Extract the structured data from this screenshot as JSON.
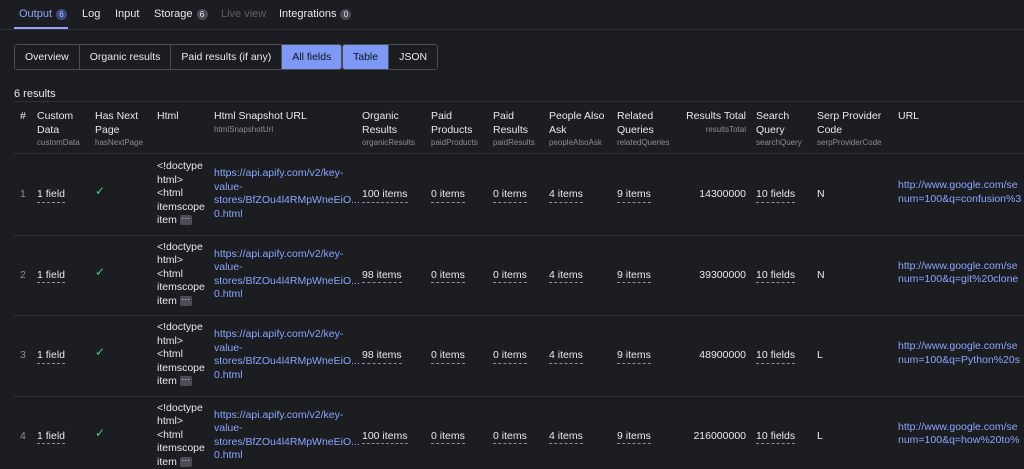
{
  "tabs": [
    {
      "label": "Output",
      "badge": "6",
      "state": "active"
    },
    {
      "label": "Log",
      "badge": "",
      "state": "normal"
    },
    {
      "label": "Input",
      "badge": "",
      "state": "normal"
    },
    {
      "label": "Storage",
      "badge": "6",
      "state": "normal"
    },
    {
      "label": "Live view",
      "badge": "",
      "state": "disabled"
    },
    {
      "label": "Integrations",
      "badge": "0",
      "state": "normal"
    }
  ],
  "view_tabs": [
    {
      "label": "Overview",
      "selected": false
    },
    {
      "label": "Organic results",
      "selected": false
    },
    {
      "label": "Paid results (if any)",
      "selected": false
    },
    {
      "label": "All fields",
      "selected": true
    }
  ],
  "format_tabs": [
    {
      "label": "Table",
      "selected": true
    },
    {
      "label": "JSON",
      "selected": false
    }
  ],
  "results_count": "6 results",
  "columns": [
    {
      "key": "index",
      "label": [
        "#"
      ],
      "sub": ""
    },
    {
      "key": "customData",
      "label": [
        "Custom",
        "Data"
      ],
      "sub": "customData"
    },
    {
      "key": "hasNextPage",
      "label": [
        "Has Next",
        "Page"
      ],
      "sub": "hasNextPage"
    },
    {
      "key": "html",
      "label": [
        "Html"
      ],
      "sub": ""
    },
    {
      "key": "htmlSnapshotUrl",
      "label": [
        "Html Snapshot URL"
      ],
      "sub": "htmlSnapshotUrl"
    },
    {
      "key": "organicResults",
      "label": [
        "Organic",
        "Results"
      ],
      "sub": "organicResults"
    },
    {
      "key": "paidProducts",
      "label": [
        "Paid",
        "Products"
      ],
      "sub": "paidProducts"
    },
    {
      "key": "paidResults",
      "label": [
        "Paid",
        "Results"
      ],
      "sub": "paidResults"
    },
    {
      "key": "peopleAlsoAsk",
      "label": [
        "People Also",
        "Ask"
      ],
      "sub": "peopleAlsoAsk"
    },
    {
      "key": "relatedQueries",
      "label": [
        "Related",
        "Queries"
      ],
      "sub": "relatedQueries"
    },
    {
      "key": "resultsTotal",
      "label": [
        "Results Total"
      ],
      "sub": "resultsTotal"
    },
    {
      "key": "searchQuery",
      "label": [
        "Search",
        "Query"
      ],
      "sub": "searchQuery"
    },
    {
      "key": "serpProviderCode",
      "label": [
        "Serp Provider",
        "Code"
      ],
      "sub": "serpProviderCode"
    },
    {
      "key": "url",
      "label": [
        "URL"
      ],
      "sub": ""
    }
  ],
  "html_preview": [
    "<!doctype",
    "html>",
    "<html",
    "itemscope",
    "item"
  ],
  "ellipsis": "···",
  "snapshot_lines": [
    "https://api.apify.com/v2/key-",
    "value-",
    "stores/BfZOu4l4RMpWneEiO...",
    "0.html"
  ],
  "rows": [
    {
      "index": "1",
      "customData": "1 field",
      "hasNextPage": "✓",
      "organicResults": "100 items",
      "paidProducts": "0 items",
      "paidResults": "0 items",
      "peopleAlsoAsk": "4 items",
      "relatedQueries": "9 items",
      "resultsTotal": "14300000",
      "searchQuery": "10 fields",
      "serpProviderCode": "N",
      "url": [
        "http://www.google.com/se",
        "num=100&q=confusion%3"
      ]
    },
    {
      "index": "2",
      "customData": "1 field",
      "hasNextPage": "✓",
      "organicResults": "98 items",
      "paidProducts": "0 items",
      "paidResults": "0 items",
      "peopleAlsoAsk": "4 items",
      "relatedQueries": "9 items",
      "resultsTotal": "39300000",
      "searchQuery": "10 fields",
      "serpProviderCode": "N",
      "url": [
        "http://www.google.com/se",
        "num=100&q=git%20clone"
      ]
    },
    {
      "index": "3",
      "customData": "1 field",
      "hasNextPage": "✓",
      "organicResults": "98 items",
      "paidProducts": "0 items",
      "paidResults": "0 items",
      "peopleAlsoAsk": "4 items",
      "relatedQueries": "9 items",
      "resultsTotal": "48900000",
      "searchQuery": "10 fields",
      "serpProviderCode": "L",
      "url": [
        "http://www.google.com/se",
        "num=100&q=Python%20s"
      ]
    },
    {
      "index": "4",
      "customData": "1 field",
      "hasNextPage": "✓",
      "organicResults": "100 items",
      "paidProducts": "0 items",
      "paidResults": "0 items",
      "peopleAlsoAsk": "4 items",
      "relatedQueries": "9 items",
      "resultsTotal": "216000000",
      "searchQuery": "10 fields",
      "serpProviderCode": "L",
      "url": [
        "http://www.google.com/se",
        "num=100&q=how%20to%"
      ]
    }
  ]
}
